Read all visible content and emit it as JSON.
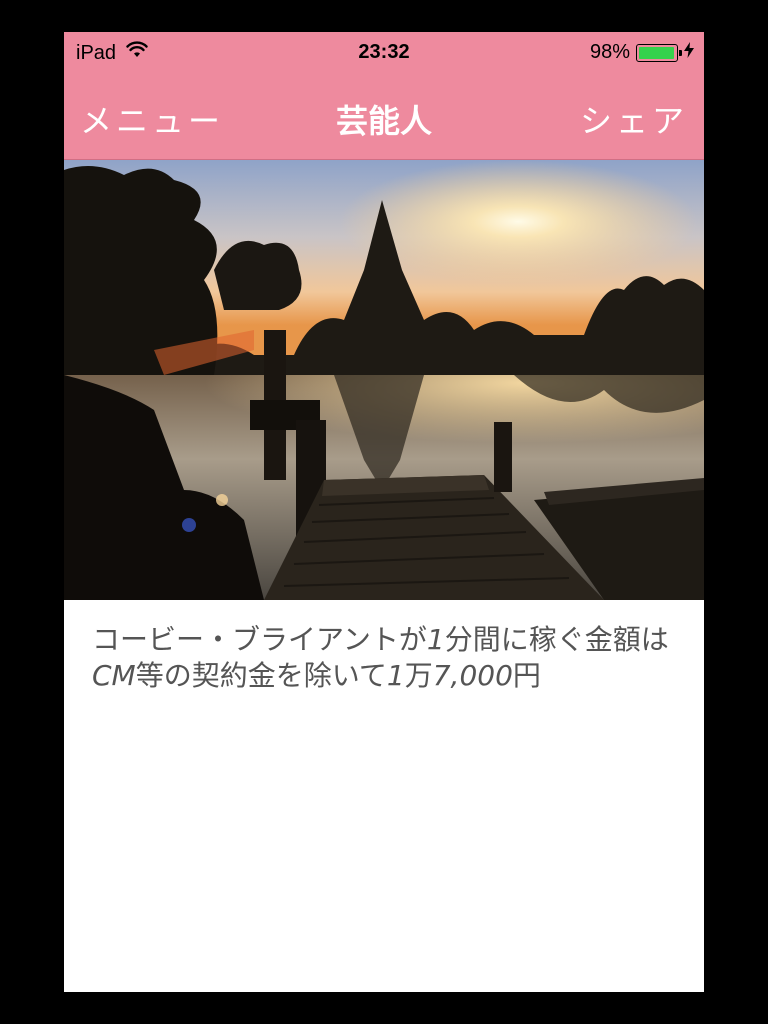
{
  "status_bar": {
    "device": "iPad",
    "time": "23:32",
    "battery_percent_label": "98%",
    "battery_level": 0.98,
    "wifi_icon": "wifi-icon",
    "charging_icon": "lightning-bolt-icon"
  },
  "nav": {
    "menu_label": "メニュー",
    "title": "芸能人",
    "share_label": "シェア"
  },
  "hero_image": {
    "description_icon": "sunset-lake-photo"
  },
  "article": {
    "segments": [
      "コービー・ブライアントが",
      "1",
      "分間に稼ぐ金額は",
      "CM",
      "等の契約金を除いて",
      "1",
      "万",
      "7,000",
      "円"
    ]
  },
  "colors": {
    "accent": "#ee8a9e",
    "text": "#555555",
    "battery_fill": "#35d24c"
  }
}
